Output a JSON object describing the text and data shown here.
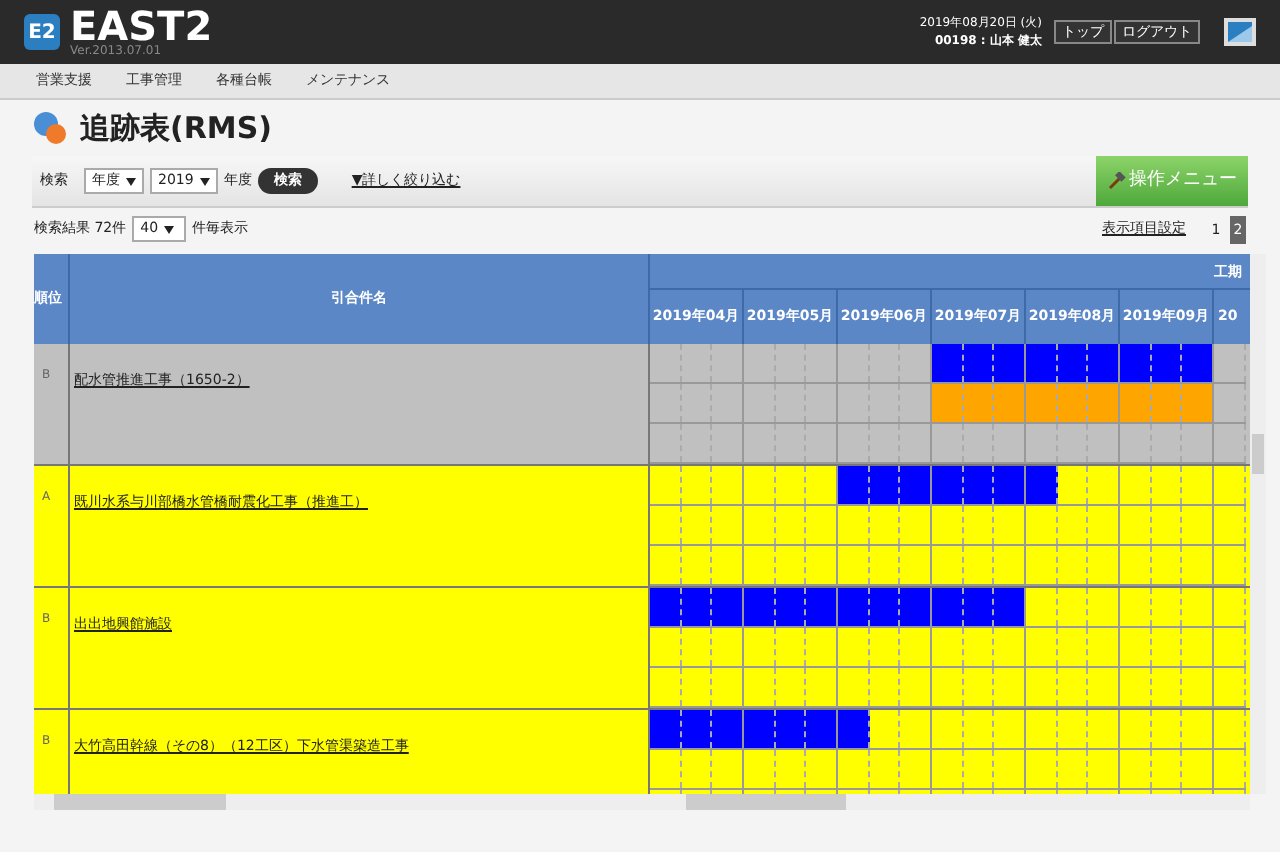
{
  "header": {
    "logo_badge": "E2",
    "logo": "EAST2",
    "version": "Ver.2013.07.01",
    "date": "2019年08月20日 (火)",
    "user": "00198 : 山本 健太",
    "buttons": [
      "トップ",
      "ログアウト"
    ]
  },
  "nav": [
    "営業支援",
    "工事管理",
    "各種台帳",
    "メンテナンス"
  ],
  "page_title": "追跡表(RMS)",
  "search": {
    "label": "検索",
    "period_select": "年度",
    "year_select": "2019",
    "year_suffix": "年度",
    "button": "検索",
    "advanced_link": "▼詳しく絞り込む",
    "menu_button": "操作メニュー"
  },
  "results": {
    "label": "検索結果 72件",
    "per_page_select": "40",
    "per_page_suffix": "件毎表示",
    "columns_link": "表示項目設定",
    "pages": [
      {
        "label": "1",
        "selected": false
      },
      {
        "label": "2",
        "selected": true
      }
    ]
  },
  "table": {
    "columns": [
      "順位",
      "引合件名"
    ],
    "gantt_group": "工期",
    "months": [
      "2019年04月",
      "2019年05月",
      "2019年06月",
      "2019年07月",
      "2019年08月",
      "2019年09月",
      "20"
    ],
    "rows": [
      {
        "rank": "B",
        "name": "配水管推進工事（1650-2）",
        "color": "#c0c0c0",
        "lanes": [
          {
            "color": "#0000ff",
            "cells": [
              {
                "filled": false
              },
              {
                "filled": false
              },
              {
                "filled": false
              },
              {
                "filled": false
              },
              {
                "filled": false
              },
              {
                "filled": false
              },
              {
                "filled": false
              },
              {
                "filled": false
              },
              {
                "filled": false
              },
              {
                "filled": true
              },
              {
                "filled": true
              },
              {
                "filled": true
              },
              {
                "filled": true
              },
              {
                "filled": true
              },
              {
                "filled": true
              },
              {
                "filled": true
              },
              {
                "filled": true
              },
              {
                "filled": true
              },
              {
                "filled": false
              }
            ]
          },
          {
            "color": "#ffa500",
            "cells": [
              {
                "filled": false
              },
              {
                "filled": false
              },
              {
                "filled": false
              },
              {
                "filled": false
              },
              {
                "filled": false
              },
              {
                "filled": false
              },
              {
                "filled": false
              },
              {
                "filled": false
              },
              {
                "filled": false
              },
              {
                "filled": true
              },
              {
                "filled": true
              },
              {
                "filled": true
              },
              {
                "filled": true
              },
              {
                "filled": true
              },
              {
                "filled": true
              },
              {
                "filled": true
              },
              {
                "filled": true
              },
              {
                "filled": true
              },
              {
                "filled": false
              }
            ]
          }
        ]
      },
      {
        "rank": "A",
        "name": "既川水系与川部橋水管橋耐震化工事（推進工）",
        "color": "#ffff00",
        "lanes": [
          {
            "color": "#0000ff",
            "cells": [
              {
                "filled": false
              },
              {
                "filled": false
              },
              {
                "filled": false
              },
              {
                "filled": false
              },
              {
                "filled": false
              },
              {
                "filled": false
              },
              {
                "filled": true
              },
              {
                "filled": true
              },
              {
                "filled": true
              },
              {
                "filled": true
              },
              {
                "filled": true
              },
              {
                "filled": true
              },
              {
                "filled": true
              },
              {
                "filled": false
              },
              {
                "filled": false
              },
              {
                "filled": false
              },
              {
                "filled": false
              },
              {
                "filled": false
              },
              {
                "filled": false
              }
            ]
          }
        ]
      },
      {
        "rank": "B",
        "name": "出出地興館施設",
        "color": "#ffff00",
        "lanes": [
          {
            "color": "#0000ff",
            "cells": [
              {
                "filled": true
              },
              {
                "filled": true
              },
              {
                "filled": true
              },
              {
                "filled": true
              },
              {
                "filled": true
              },
              {
                "filled": true
              },
              {
                "filled": true
              },
              {
                "filled": true
              },
              {
                "filled": true
              },
              {
                "filled": true
              },
              {
                "filled": true
              },
              {
                "filled": true
              },
              {
                "filled": false
              },
              {
                "filled": false
              },
              {
                "filled": false
              },
              {
                "filled": false
              },
              {
                "filled": false
              },
              {
                "filled": false
              },
              {
                "filled": false
              }
            ]
          }
        ]
      },
      {
        "rank": "B",
        "name": "大竹高田幹線（その8）（12工区）下水管渠築造工事",
        "color": "#ffff00",
        "lanes": [
          {
            "color": "#0000ff",
            "cells": [
              {
                "filled": true
              },
              {
                "filled": true
              },
              {
                "filled": true
              },
              {
                "filled": true
              },
              {
                "filled": true
              },
              {
                "filled": true
              },
              {
                "filled": true
              },
              {
                "filled": false
              },
              {
                "filled": false
              },
              {
                "filled": false
              },
              {
                "filled": false
              },
              {
                "filled": false
              },
              {
                "filled": false
              },
              {
                "filled": false
              },
              {
                "filled": false
              },
              {
                "filled": false
              },
              {
                "filled": false
              },
              {
                "filled": false
              },
              {
                "filled": false
              }
            ]
          }
        ]
      }
    ]
  }
}
